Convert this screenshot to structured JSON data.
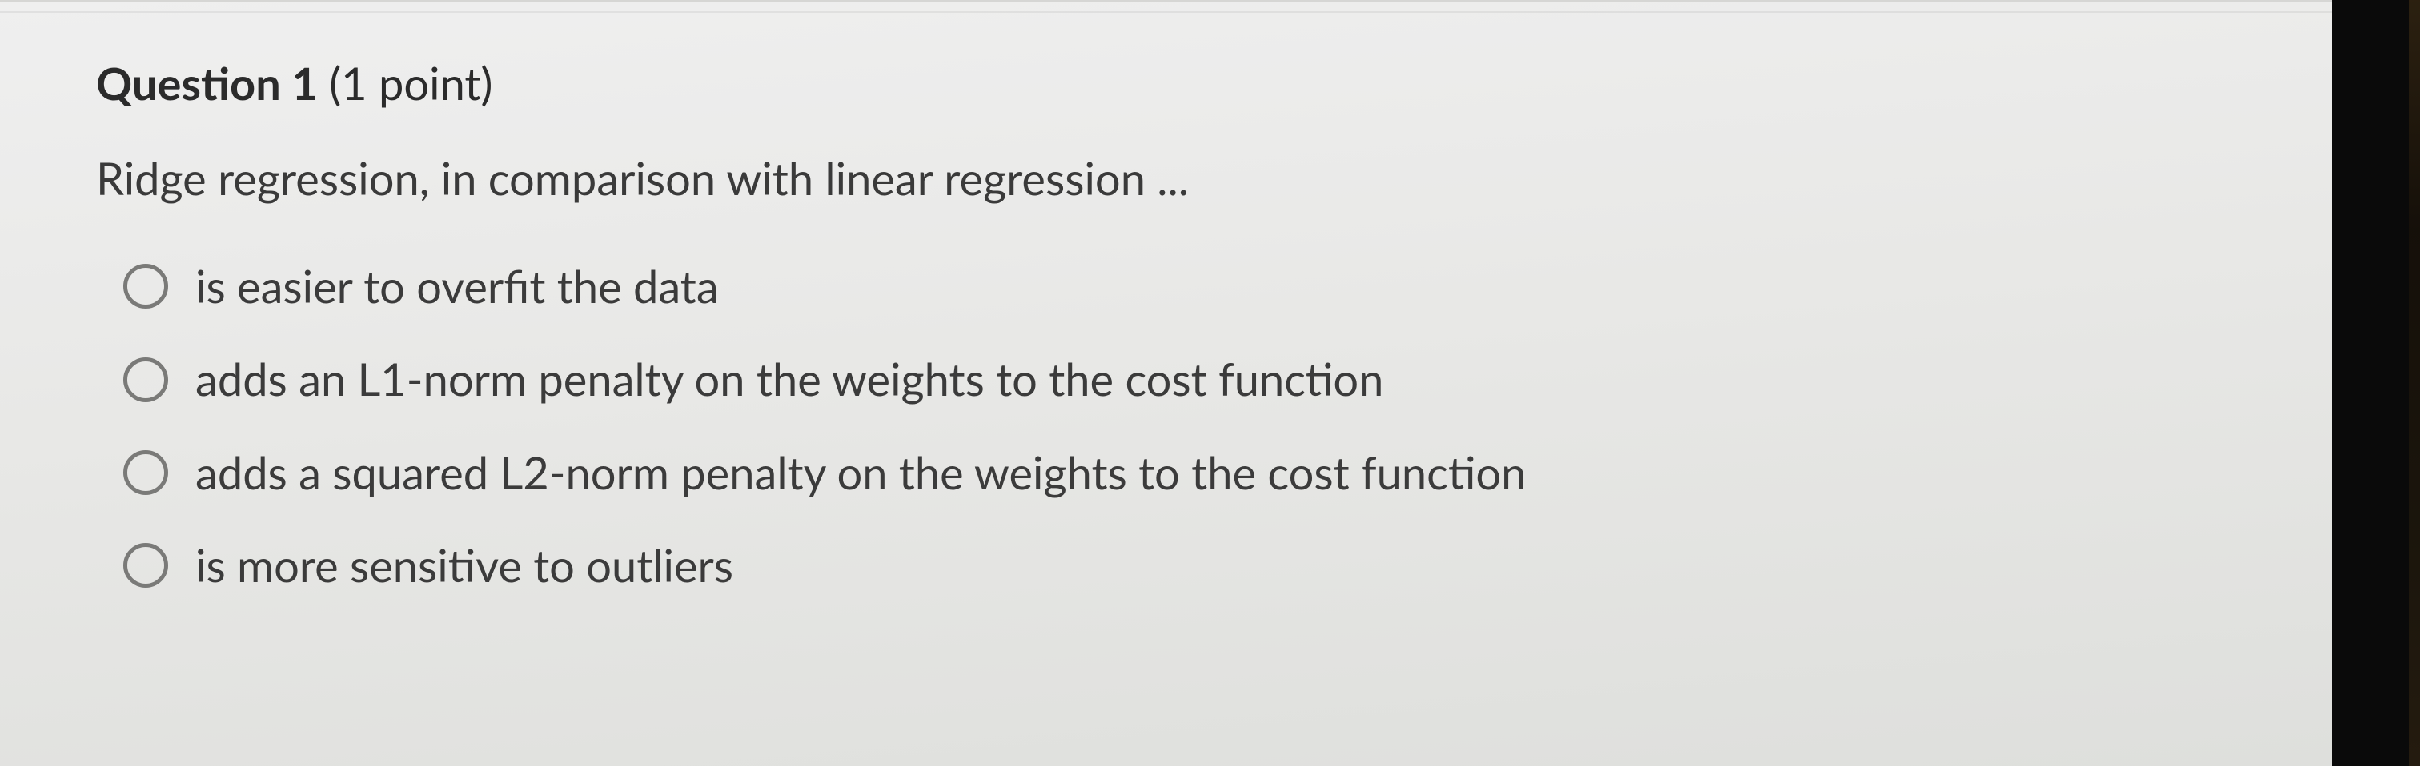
{
  "question": {
    "label": "Question 1",
    "points": "(1 point)",
    "prompt": "Ridge regression, in comparison with linear regression ...",
    "options": [
      {
        "text": "is easier to overfit the data"
      },
      {
        "text": "adds an L1-norm penalty on the weights to the cost function"
      },
      {
        "text": "adds a squared L2-norm penalty on the weights to the cost function"
      },
      {
        "text": "is more sensitive to outliers"
      }
    ]
  }
}
